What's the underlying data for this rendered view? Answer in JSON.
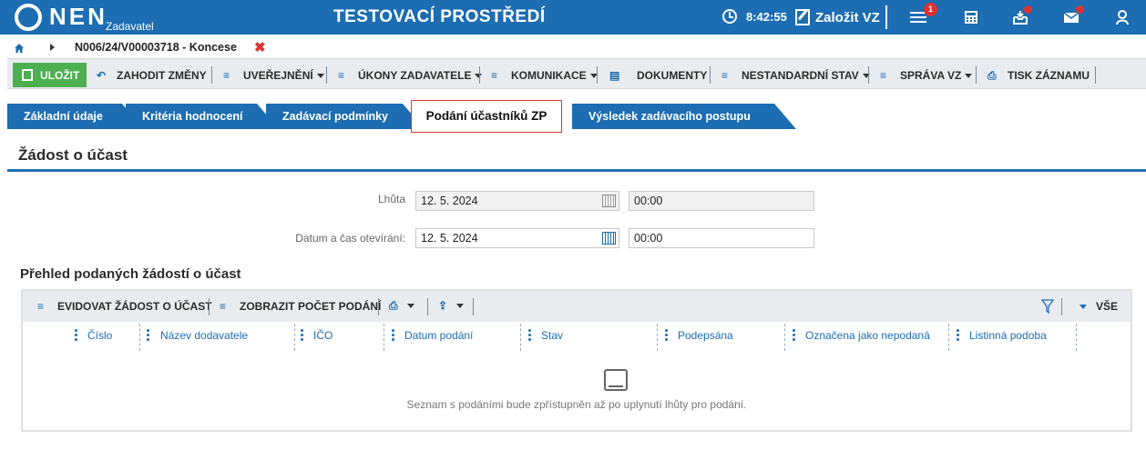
{
  "header": {
    "logo_text": "NEN",
    "logo_sub": "Zadavatel",
    "environment": "TESTOVACÍ PROSTŘEDÍ",
    "time": "8:42:55",
    "new_vz_label": "Založit VZ",
    "notification_count": "1",
    "icons": [
      "clock-icon",
      "edit-icon",
      "menu-icon",
      "calculator-icon",
      "inbox-icon",
      "mail-icon",
      "user-icon"
    ]
  },
  "breadcrumb": {
    "text": "N006/24/V00003718 - Koncese",
    "close": "✖"
  },
  "toolbar": {
    "save": "ULOŽIT",
    "discard": "ZAHODIT ZMĚNY",
    "publish": "UVEŘEJNĚNÍ",
    "actions": "ÚKONY ZADAVATELE",
    "communication": "KOMUNIKACE",
    "documents": "DOKUMENTY",
    "nonstandard": "NESTANDARDNÍ STAV",
    "admin": "SPRÁVA VZ",
    "print": "TISK ZÁZNAMU"
  },
  "tabs": [
    {
      "label": "Základní údaje"
    },
    {
      "label": "Kritéria hodnocení"
    },
    {
      "label": "Zadávací podmínky"
    },
    {
      "label": "Podání účastníků ZP"
    },
    {
      "label": "Výsledek zadávacího postupu"
    }
  ],
  "section": {
    "title": "Žádost o účast"
  },
  "form": {
    "deadline_label": "Lhůta",
    "deadline_date": "12. 5. 2024",
    "deadline_time": "00:00",
    "opening_label": "Datum a čas otevírání:",
    "opening_date": "12. 5. 2024",
    "opening_time": "00:00"
  },
  "grid": {
    "title": "Přehled podaných žádostí o účast",
    "register": "EVIDOVAT ŽÁDOST O ÚČAST",
    "show_count": "ZOBRAZIT POČET PODÁNÍ",
    "all": "VŠE",
    "columns": [
      "Číslo",
      "Název dodavatele",
      "IČO",
      "Datum podání",
      "Stav",
      "Podepsána",
      "Označena jako nepodaná",
      "Listinná podoba"
    ],
    "empty_message": "Seznam s podáními bude zpřístupněn až po uplynutí lhůty pro podání."
  },
  "colors": {
    "primary": "#1c6db2",
    "save_green": "#4caf50",
    "alert_red": "#e03131",
    "toolbar_bg": "#e9ecef"
  }
}
